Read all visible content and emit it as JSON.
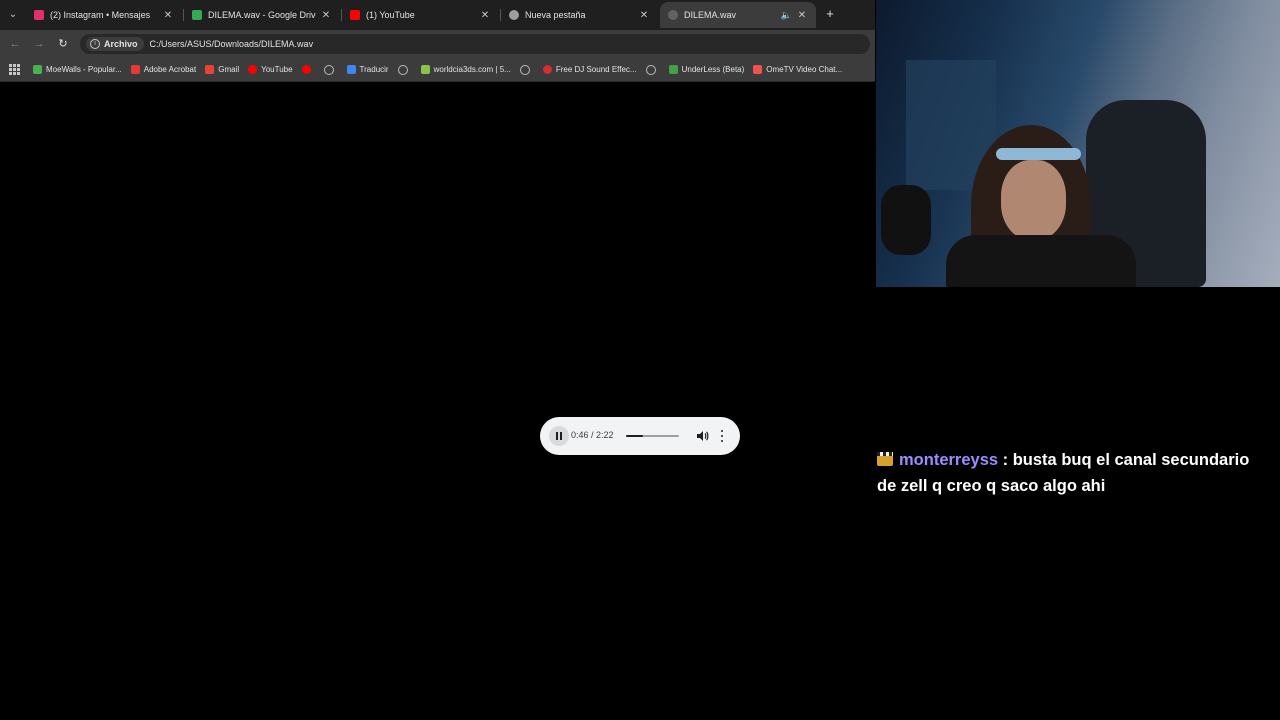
{
  "tabs": [
    {
      "title": "(2) Instagram • Mensajes",
      "favicon_color": "#e1306c",
      "active": false
    },
    {
      "title": "DILEMA.wav - Google Drive",
      "favicon_color": "#34a853",
      "active": false
    },
    {
      "title": "(1) YouTube",
      "favicon_color": "#ff0000",
      "active": false
    },
    {
      "title": "Nueva pestaña",
      "favicon_color": "#9e9e9e",
      "active": false
    },
    {
      "title": "DILEMA.wav",
      "favicon_color": "#5f6368",
      "active": true,
      "playing_audio": true
    }
  ],
  "toolbar": {
    "chip_label": "Archivo",
    "url": "C:/Users/ASUS/Downloads/DILEMA.wav"
  },
  "bookmarks": [
    {
      "label": "MoeWalls - Popular...",
      "icon_color": "#4caf50"
    },
    {
      "label": "Adobe Acrobat",
      "icon_color": "#e53935"
    },
    {
      "label": "Gmail",
      "icon_color": "#ea4335"
    },
    {
      "label": "YouTube",
      "icon_color": "#ff0000"
    },
    {
      "label": "",
      "icon_color": "#ff0000"
    },
    {
      "label": "",
      "icon": "globe-icon"
    },
    {
      "label": "Traducir",
      "icon_color": "#4285f4"
    },
    {
      "label": "",
      "icon": "globe-icon"
    },
    {
      "label": "worldcia3ds.com | 5...",
      "icon_color": "#8bc34a"
    },
    {
      "label": "",
      "icon": "globe-icon"
    },
    {
      "label": "Free DJ Sound Effec...",
      "icon_color": "#d32f2f"
    },
    {
      "label": "",
      "icon": "globe-icon"
    },
    {
      "label": "UnderLess (Beta)",
      "icon_color": "#43a047"
    },
    {
      "label": "OmeTV Video Chat...",
      "icon_color": "#ef5350"
    }
  ],
  "player": {
    "time": "0:46 / 2:22",
    "progress": 0.324
  },
  "chat": {
    "username": "monterreyss",
    "message": " : busta buq el canal secundario de zell q creo q saco algo ahi"
  }
}
